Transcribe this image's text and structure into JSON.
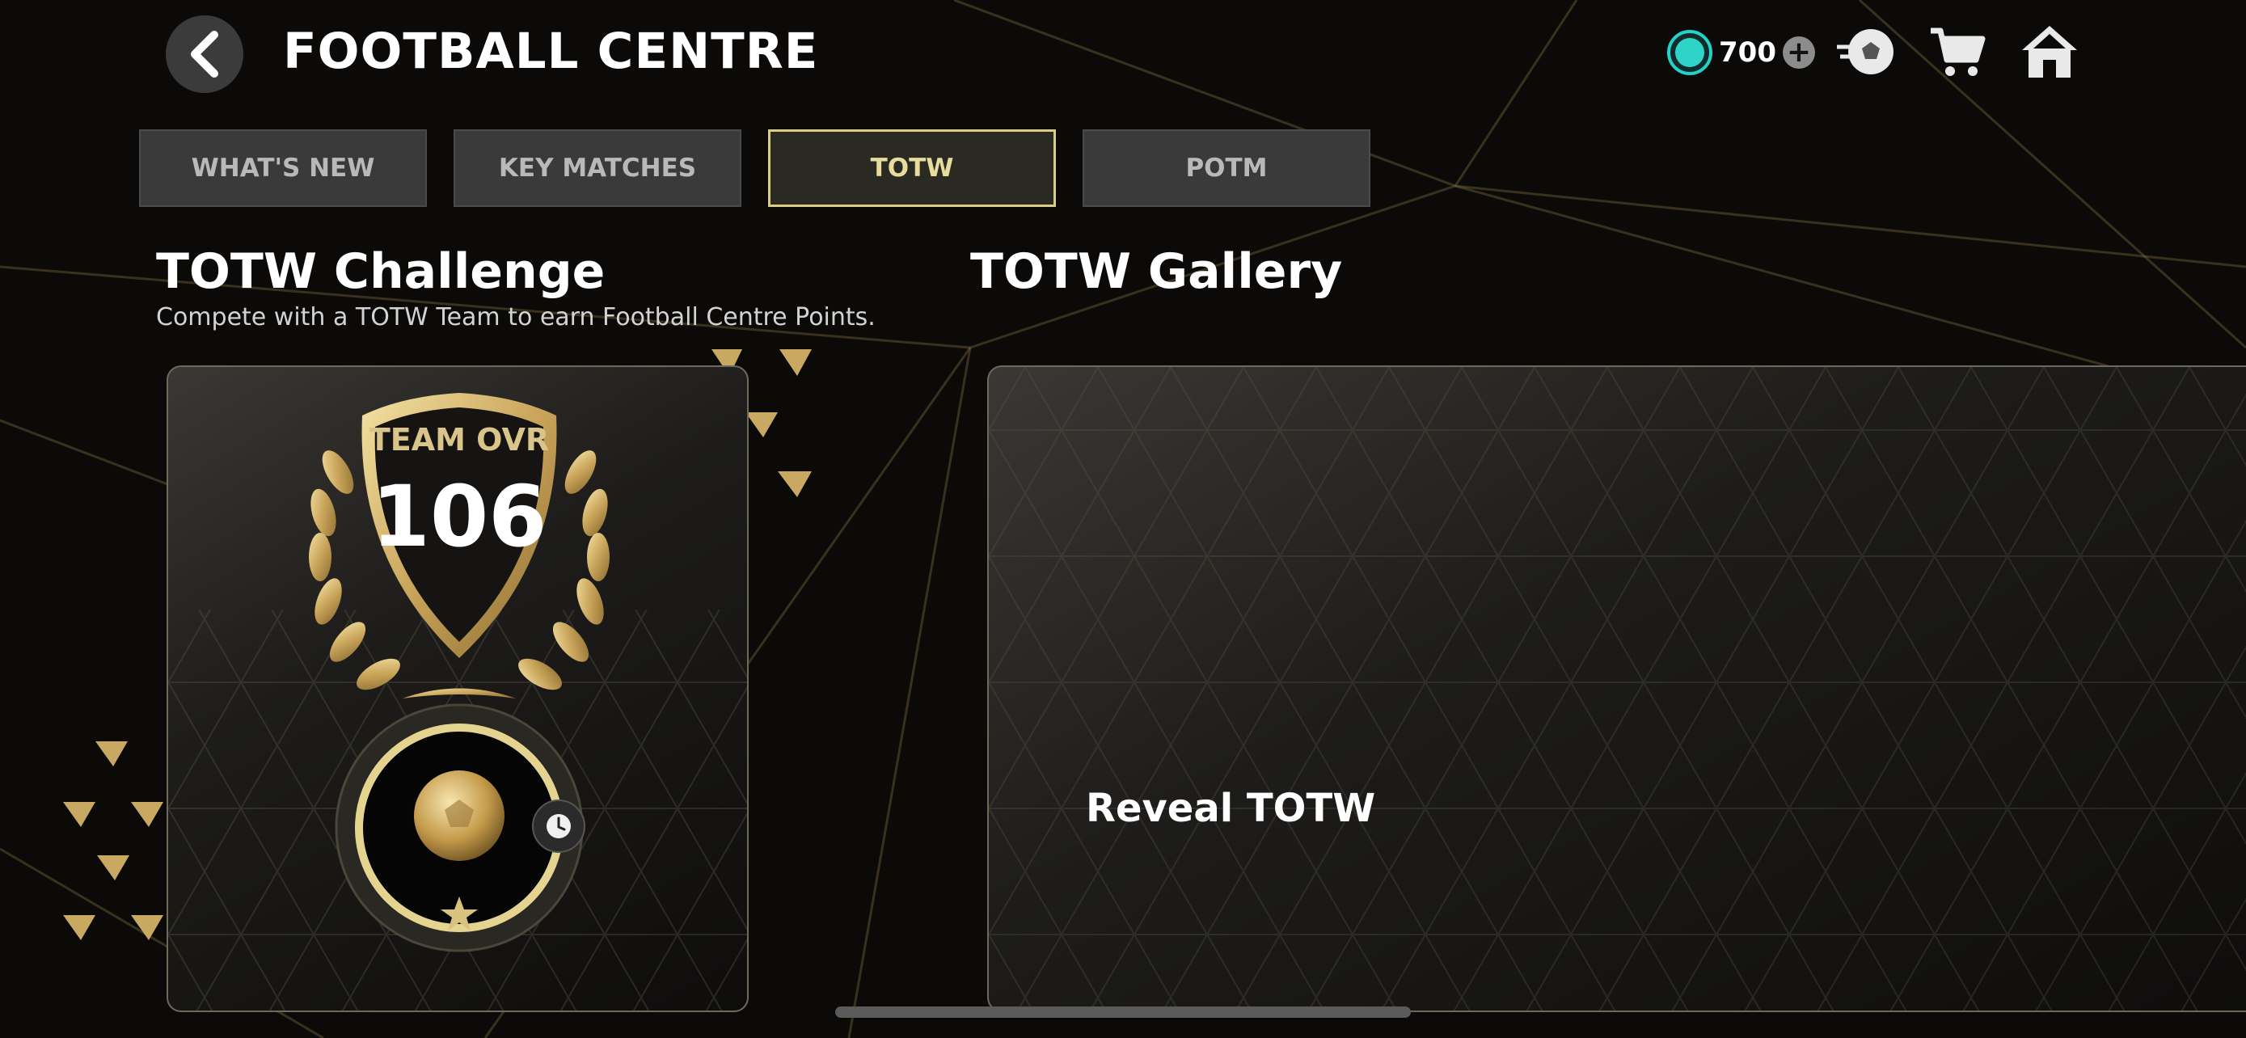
{
  "header": {
    "title": "FOOTBALL CENTRE",
    "currency_value": "700",
    "currency_icon": "football-centre-points-icon",
    "icons": [
      "packs-icon",
      "store-cart-icon",
      "home-icon"
    ]
  },
  "tabs": [
    {
      "label": "WHAT'S NEW",
      "active": false
    },
    {
      "label": "KEY MATCHES",
      "active": false
    },
    {
      "label": "TOTW",
      "active": true
    },
    {
      "label": "POTM",
      "active": false
    }
  ],
  "challenge": {
    "title": "TOTW Challenge",
    "subtitle": "Compete with a TOTW Team to earn Football Centre Points.",
    "badge_label": "TEAM OVR",
    "badge_value": "106"
  },
  "gallery": {
    "title": "TOTW Gallery",
    "action_label": "Reveal TOTW"
  },
  "colors": {
    "accent_gold": "#d8cc86",
    "currency_teal": "#23d3c8",
    "background": "#0b0a09"
  }
}
